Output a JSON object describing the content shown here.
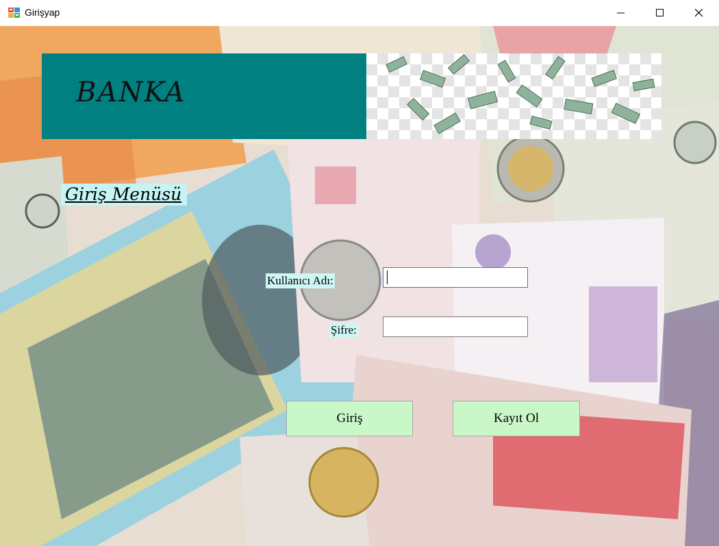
{
  "window": {
    "title": "Girişyap",
    "controls": [
      "minimize",
      "maximize",
      "close"
    ]
  },
  "header": {
    "title": "BANKA"
  },
  "menu": {
    "title": "Giriş Menüsü"
  },
  "form": {
    "username_label": "Kullanıcı Adı:",
    "username_value": "",
    "password_label": "Şifre:",
    "password_value": ""
  },
  "buttons": {
    "login": "Giriş",
    "register": "Kayıt Ol"
  },
  "colors": {
    "header_banner": "#008080",
    "label_background": "#cdf7f5",
    "button_background": "#c9f7c7"
  }
}
